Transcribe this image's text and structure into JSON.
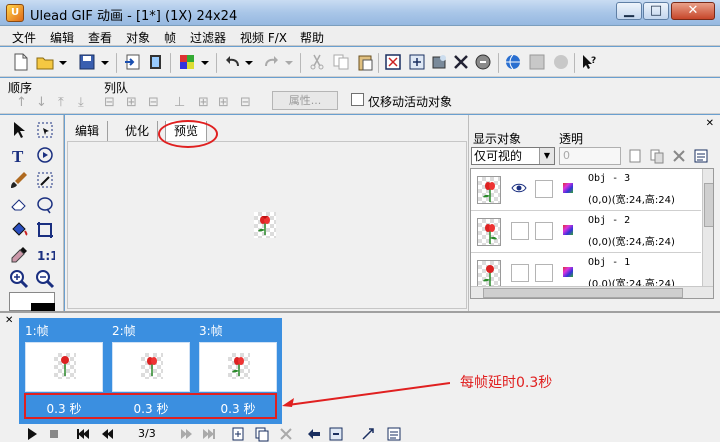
{
  "window": {
    "app_icon_letter": "U",
    "title": "Ulead GIF 动画 - [1*] (1X) 24x24",
    "min_label": "▁",
    "max_label": "□",
    "close_label": "✕"
  },
  "menu": [
    "文件",
    "编辑",
    "查看",
    "对象",
    "帧",
    "过滤器",
    "视频 F/X",
    "帮助"
  ],
  "queue": {
    "title_left": "顺序",
    "title_right": "列队",
    "property_button": "属性...",
    "move_active_only": "仅移动活动对象"
  },
  "editor": {
    "tabs": [
      "编辑",
      "优化",
      "预览"
    ],
    "active_tab_index": 2
  },
  "objects_panel": {
    "label_display": "显示对象",
    "label_transparency": "透明",
    "display_select": "仅可视的",
    "transparency_value": "0",
    "objects": [
      {
        "name": "Obj - 3",
        "coord": "(0,0)(宽:24,高:24)",
        "visible": true
      },
      {
        "name": "Obj - 2",
        "coord": "(0,0)(宽:24,高:24)",
        "visible": false
      },
      {
        "name": "Obj - 1",
        "coord": "(0,0)(宽:24,高:24)",
        "visible": false
      }
    ]
  },
  "frames": {
    "items": [
      {
        "label": "1:帧",
        "delay": "0.3 秒"
      },
      {
        "label": "2:帧",
        "delay": "0.3 秒"
      },
      {
        "label": "3:帧",
        "delay": "0.3 秒"
      }
    ],
    "counter": "3/3",
    "annotation": "每帧延时0.3秒"
  },
  "colors": {
    "frame_strip": "#3b8fe0",
    "annotation_red": "#e02020"
  }
}
